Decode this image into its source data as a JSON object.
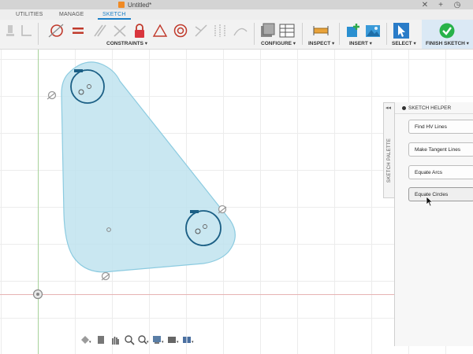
{
  "window": {
    "title": "Untitled*"
  },
  "tabs": [
    {
      "label": "UTILITIES"
    },
    {
      "label": "MANAGE"
    },
    {
      "label": "SKETCH"
    }
  ],
  "ribbon": {
    "groups": {
      "constraints": "CONSTRAINTS ▾",
      "configure": "CONFIGURE ▾",
      "inspect": "INSPECT ▾",
      "insert": "INSERT ▾",
      "select": "SELECT ▾",
      "finish_sketch": "FINISH SKETCH ▾"
    }
  },
  "sketch_palette": {
    "tab_label": "SKETCH PALETTE",
    "panel_title": "SKETCH HELPER",
    "buttons": [
      {
        "label": "Find HV Lines"
      },
      {
        "label": "Make Tangent Lines"
      },
      {
        "label": "Equate Arcs"
      },
      {
        "label": "Equate Circles"
      }
    ]
  },
  "colors": {
    "sketch_fill": "#bfe3ef",
    "sketch_stroke": "#8ccbe0",
    "circle_stroke": "#1b5f85",
    "accent": "#1a7fc6",
    "finish_green": "#27b24a"
  },
  "icons": {
    "nav_bar": [
      "orbit-icon",
      "pan-icon",
      "zoom-icon",
      "zoom-window-icon",
      "display-settings-icon",
      "grid-settings-icon",
      "viewports-icon"
    ]
  }
}
